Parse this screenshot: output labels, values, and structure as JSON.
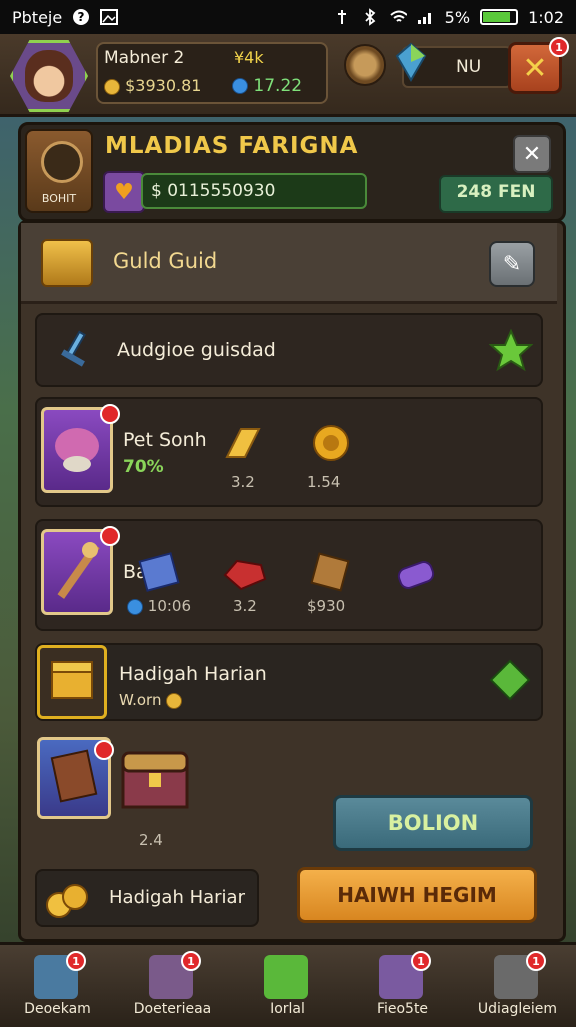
{
  "status_bar": {
    "carrier": "Pbteje",
    "battery_pct": "5%",
    "time": "1:02",
    "battery_level": 0.85
  },
  "player": {
    "name": "Mabner 2",
    "level": "¥4k",
    "gold": "$3930.81",
    "gems": "17.22"
  },
  "top_right": {
    "resource_label": "NU",
    "close_badge": "1"
  },
  "guild_header": {
    "emblem_label": "BOHIT",
    "title": "MLADIAS FARIGNA",
    "stat_value": "$ 0115550930",
    "rank_label": "248 FEN"
  },
  "main_panel": {
    "title": "Guld Guid",
    "row1_title": "Audgioe guisdad",
    "row2": {
      "title": "Pet Sonh",
      "percent": "70%",
      "loot_a": "3.2",
      "loot_b": "1.54"
    },
    "row3": {
      "title": "Balb",
      "time": "10:06",
      "loot_a": "3.2",
      "loot_b": "$930"
    },
    "row4": {
      "title": "Hadigah Harian",
      "sub": "W.orn"
    },
    "chest_count": "2.4",
    "bolion_button": "BOLION",
    "row5_title": "Hadigah Hariar",
    "haiwh_button": "HAIWH HEGIM"
  },
  "bottom_nav": [
    {
      "label": "Deoekam",
      "badge": "1",
      "icon": "home-card-icon"
    },
    {
      "label": "Doeterieaa",
      "badge": "1",
      "icon": "cards-icon"
    },
    {
      "label": "Iorlal",
      "badge": "",
      "icon": "green-block-icon"
    },
    {
      "label": "Fieo5te",
      "badge": "1",
      "icon": "map-icon"
    },
    {
      "label": "Udiagleiem",
      "badge": "1",
      "icon": "stone-icon"
    }
  ],
  "colors": {
    "accent_gold": "#f0c84a",
    "accent_green": "#8ad45a",
    "badge_red": "#e0282a",
    "orange_button": "#d88620",
    "teal_button": "#3a6a7a"
  }
}
